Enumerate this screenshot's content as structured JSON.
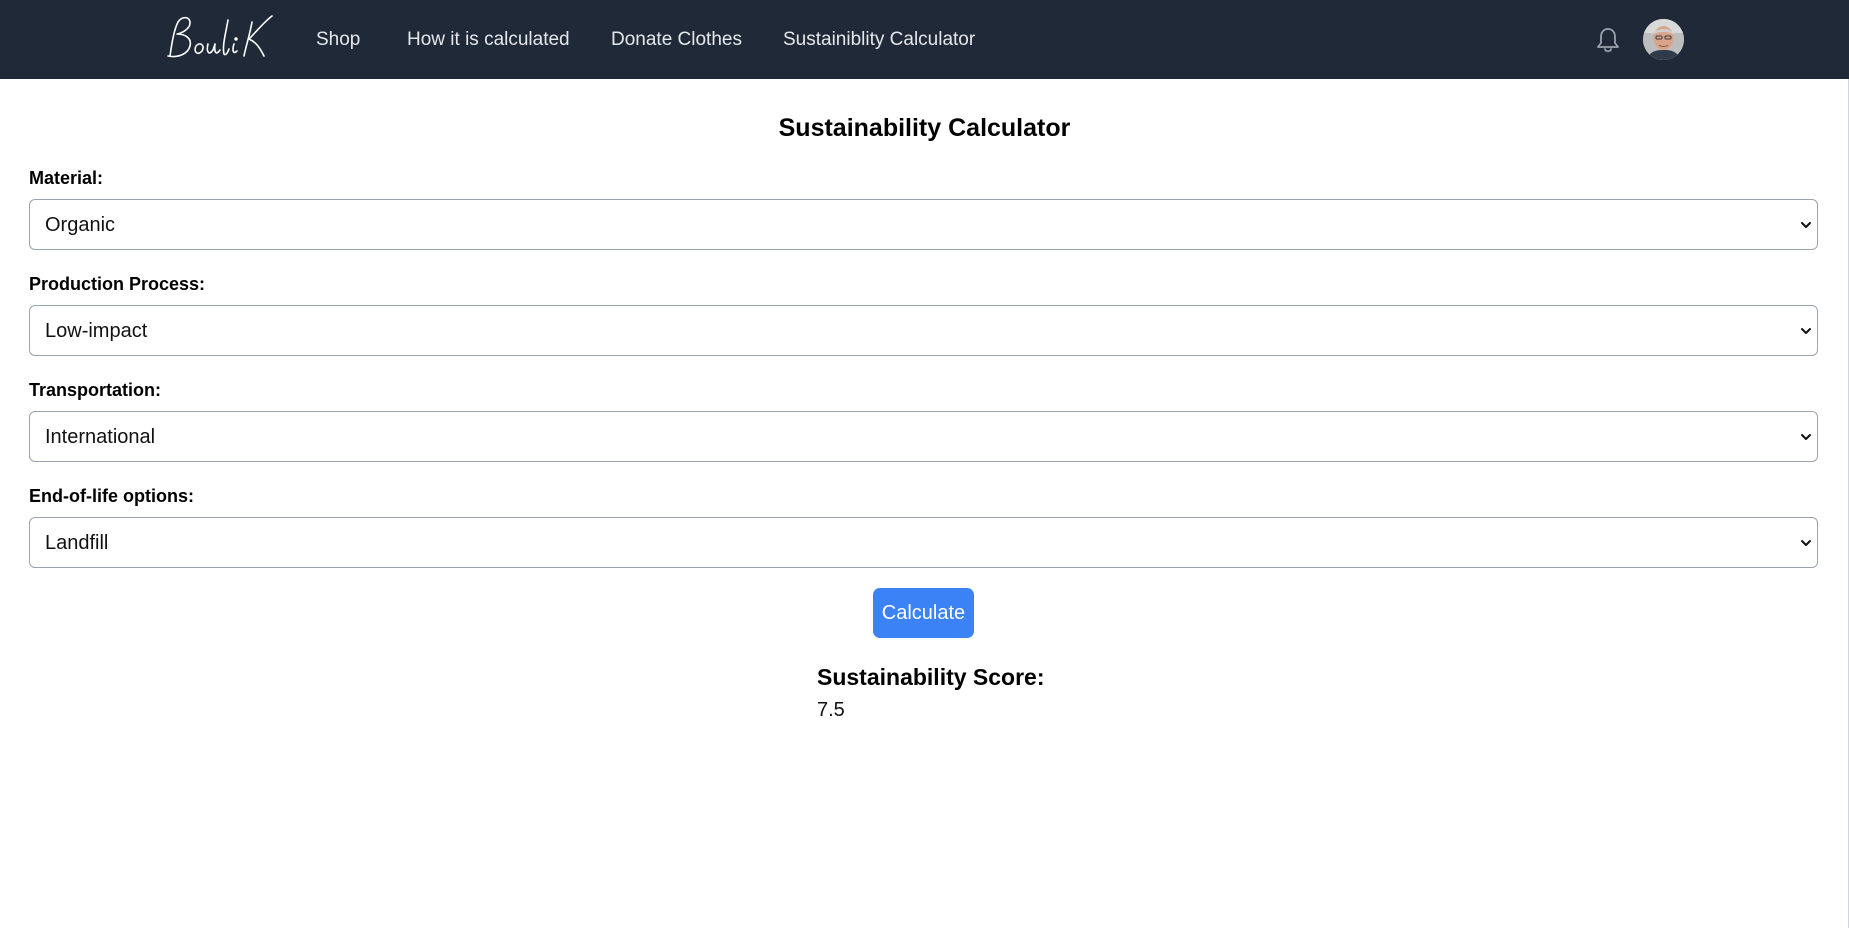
{
  "navbar": {
    "logo_text": "Bouli K",
    "links": [
      {
        "label": "Shop"
      },
      {
        "label": "How it is calculated"
      },
      {
        "label": "Donate Clothes"
      },
      {
        "label": "Sustainiblity Calculator"
      }
    ],
    "icons": {
      "notifications": "bell-icon",
      "profile": "avatar"
    },
    "background_color": "#1f2937"
  },
  "form": {
    "title": "Sustainability Calculator",
    "fields": [
      {
        "label": "Material:",
        "selected": "Organic"
      },
      {
        "label": "Production Process:",
        "selected": "Low-impact"
      },
      {
        "label": "Transportation:",
        "selected": "International"
      },
      {
        "label": "End-of-life options:",
        "selected": "Landfill"
      }
    ],
    "calculate_label": "Calculate",
    "accent_color": "#3b82f6"
  },
  "result": {
    "heading": "Sustainability Score:",
    "value": "7.5"
  }
}
